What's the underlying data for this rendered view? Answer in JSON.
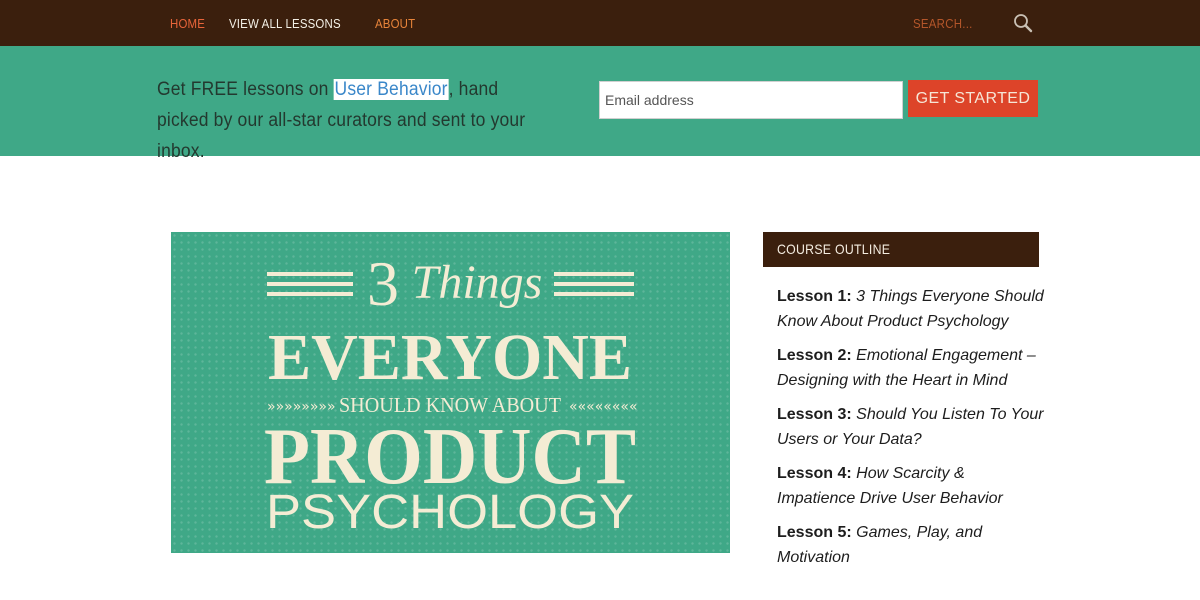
{
  "nav": {
    "home": "HOME",
    "view_all": "VIEW ALL LESSONS",
    "about": "ABOUT",
    "search_placeholder": "SEARCH..."
  },
  "banner": {
    "text_before": "Get FREE lessons on ",
    "highlight": "User Behavior",
    "text_after": ", hand picked by our all-star curators and sent to your inbox.",
    "email_placeholder": "Email address",
    "cta": "GET STARTED"
  },
  "hero": {
    "number": "3",
    "script_word": "Things",
    "line1": "EVERYONE",
    "line2": "SHOULD KNOW ABOUT",
    "line3": "PRODUCT",
    "line4": "PSYCHOLOGY"
  },
  "sidebar": {
    "heading": "COURSE OUTLINE",
    "lessons": [
      {
        "label": "Lesson 1:",
        "title": "3 Things Everyone Should Know About Product Psychology"
      },
      {
        "label": "Lesson 2:",
        "title": "Emotional Engagement – Designing with the Heart in Mind"
      },
      {
        "label": "Lesson 3:",
        "title": "Should You Listen To Your Users or Your Data?"
      },
      {
        "label": "Lesson 4:",
        "title": "How Scarcity & Impatience Drive User Behavior"
      },
      {
        "label": "Lesson 5:",
        "title": "Games, Play, and Motivation"
      }
    ]
  },
  "colors": {
    "topbar": "#3b1f0d",
    "banner": "#3fa887",
    "accent_orange": "#e8643a",
    "cta_red": "#dd4429",
    "hero_cream": "#f4ecd4"
  },
  "icons": {
    "search": "magnifier-icon"
  }
}
